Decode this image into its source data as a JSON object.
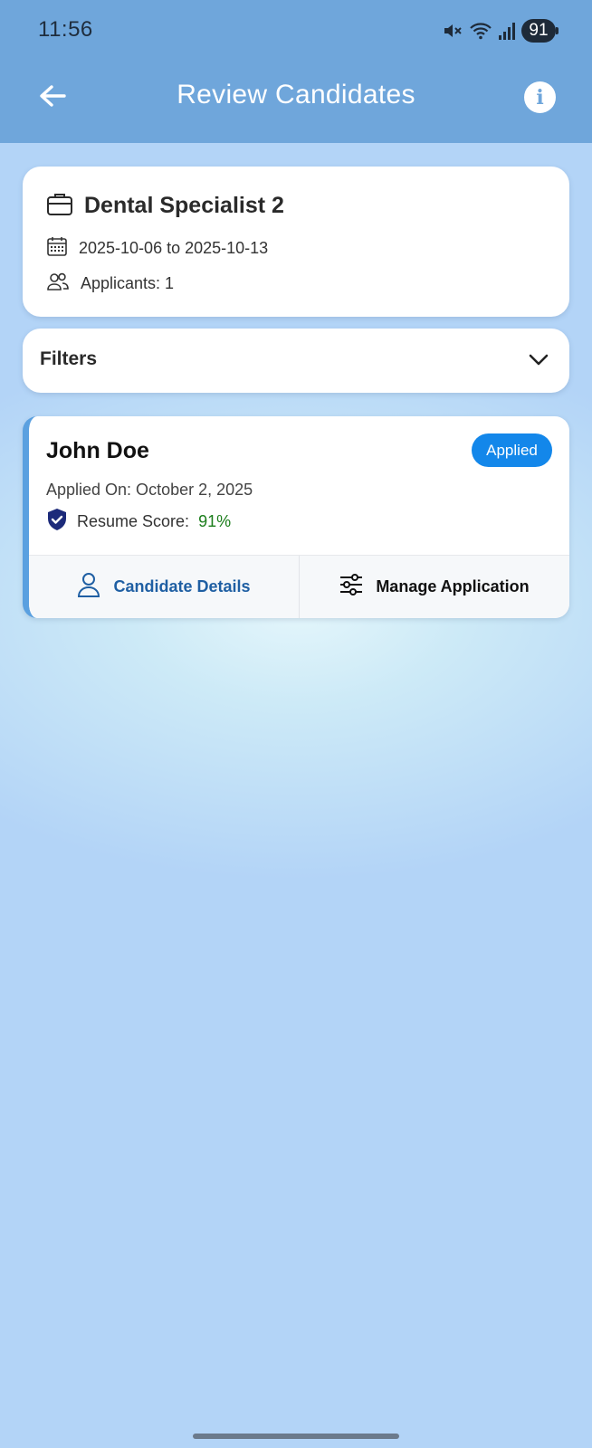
{
  "status_bar": {
    "time": "11:56",
    "battery": "91",
    "icons": [
      "mute-icon",
      "wifi-icon",
      "signal-icon",
      "battery-icon"
    ]
  },
  "header": {
    "title": "Review Candidates",
    "back_icon": "arrow-left-icon",
    "info_icon": "info-icon",
    "info_glyph": "i",
    "background": "#6fa6db"
  },
  "job": {
    "title": "Dental Specialist 2",
    "date_range": "2025-10-06 to 2025-10-13",
    "applicants": "Applicants: 1"
  },
  "filters": {
    "label": "Filters"
  },
  "candidates": [
    {
      "name": "John Doe",
      "status": "Applied",
      "applied_on": "Applied On: October 2, 2025",
      "score_label": "Resume Score:",
      "score_value": "91%",
      "actions": {
        "details": "Candidate Details",
        "manage": "Manage Application"
      }
    }
  ],
  "colors": {
    "accent": "#1387ea",
    "score_green": "#1b7d1b",
    "details_blue": "#1f5fa3",
    "shield_navy": "#1c2a7a"
  }
}
